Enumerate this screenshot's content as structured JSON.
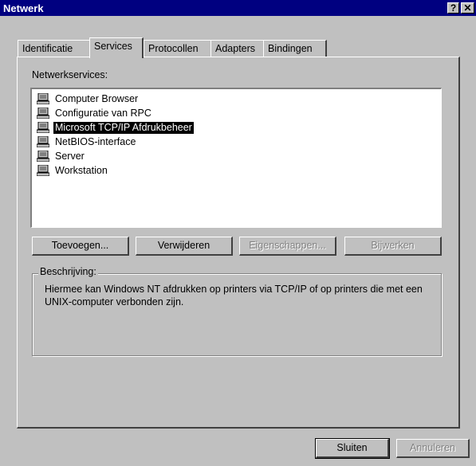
{
  "window": {
    "title": "Netwerk"
  },
  "titlebar": {
    "help_label": "?",
    "close_label": "✕"
  },
  "tabs": [
    {
      "label": "Identificatie"
    },
    {
      "label": "Services"
    },
    {
      "label": "Protocollen"
    },
    {
      "label": "Adapters"
    },
    {
      "label": "Bindingen"
    }
  ],
  "services": {
    "label": "Netwerkservices:",
    "items": [
      {
        "label": "Computer Browser",
        "icon": "network-computer-icon"
      },
      {
        "label": "Configuratie van RPC",
        "icon": "network-computer-icon"
      },
      {
        "label": "Microsoft TCP/IP Afdrukbeheer",
        "icon": "network-computer-icon",
        "selected": true
      },
      {
        "label": "NetBIOS-interface",
        "icon": "network-computer-icon"
      },
      {
        "label": "Server",
        "icon": "network-computer-icon"
      },
      {
        "label": "Workstation",
        "icon": "network-computer-icon"
      }
    ]
  },
  "buttons": {
    "add": "Toevoegen...",
    "remove": "Verwijderen",
    "properties": "Eigenschappen...",
    "update": "Bijwerken"
  },
  "description": {
    "title": "Beschrijving:",
    "text": "Hiermee kan Windows NT afdrukken op printers via TCP/IP of op printers die met een UNIX-computer verbonden zijn."
  },
  "footer": {
    "close": "Sluiten",
    "cancel": "Annuleren"
  }
}
